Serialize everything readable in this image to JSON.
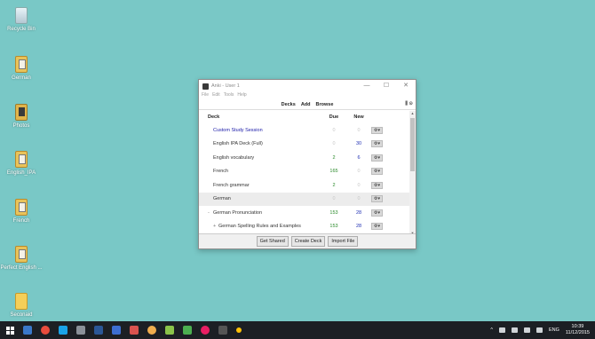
{
  "desktop": {
    "icons": [
      {
        "label": "Recycle Bin",
        "icon": "recycle-bin-icon"
      },
      {
        "label": "German",
        "icon": "document-icon"
      },
      {
        "label": "Photos",
        "icon": "photo-icon"
      },
      {
        "label": "English_IPA",
        "icon": "document-icon"
      },
      {
        "label": "French",
        "icon": "document-icon"
      },
      {
        "label": "Perfect English ...",
        "icon": "document-icon"
      },
      {
        "label": "Seconaid",
        "icon": "folder-icon"
      }
    ]
  },
  "window": {
    "title": "Anki - User 1",
    "controls": {
      "minimize": "—",
      "maximize": "☐",
      "close": "✕"
    },
    "menu": [
      "File",
      "Edit",
      "Tools",
      "Help"
    ],
    "toolbar": {
      "decks": "Decks",
      "add": "Add",
      "browse": "Browse",
      "sync_icon": "sync-icon"
    },
    "deck_list": {
      "headers": {
        "deck": "Deck",
        "due": "Due",
        "new": "New"
      },
      "rows": [
        {
          "name": "Custom Study Session",
          "due": "0",
          "new": "0",
          "expander": "",
          "filtered": true
        },
        {
          "name": "English IPA Deck (Full)",
          "due": "0",
          "new": "30",
          "expander": ""
        },
        {
          "name": "English vocabulary",
          "due": "2",
          "new": "6",
          "expander": ""
        },
        {
          "name": "French",
          "due": "165",
          "new": "0",
          "expander": ""
        },
        {
          "name": "French grammar",
          "due": "2",
          "new": "0",
          "expander": ""
        },
        {
          "name": "German",
          "due": "0",
          "new": "0",
          "expander": "",
          "current": true
        },
        {
          "name": "German Pronunciation",
          "due": "153",
          "new": "28",
          "expander": "-"
        },
        {
          "name": "German Spelling Rules and Examples",
          "due": "153",
          "new": "28",
          "expander": "+"
        }
      ]
    },
    "bottom_buttons": {
      "get_shared": "Get Shared",
      "create_deck": "Create Deck",
      "import_file": "Import File"
    }
  },
  "taskbar": {
    "tray": {
      "language": "ENG",
      "time": "10:39",
      "date": "11/12/2015"
    }
  },
  "colors": {
    "desktop": "#79c8c6",
    "due": "#2a8a2a",
    "new": "#1f2fb3",
    "filtered_deck": "#1a1aa8",
    "taskbar": "#1c1f24"
  }
}
